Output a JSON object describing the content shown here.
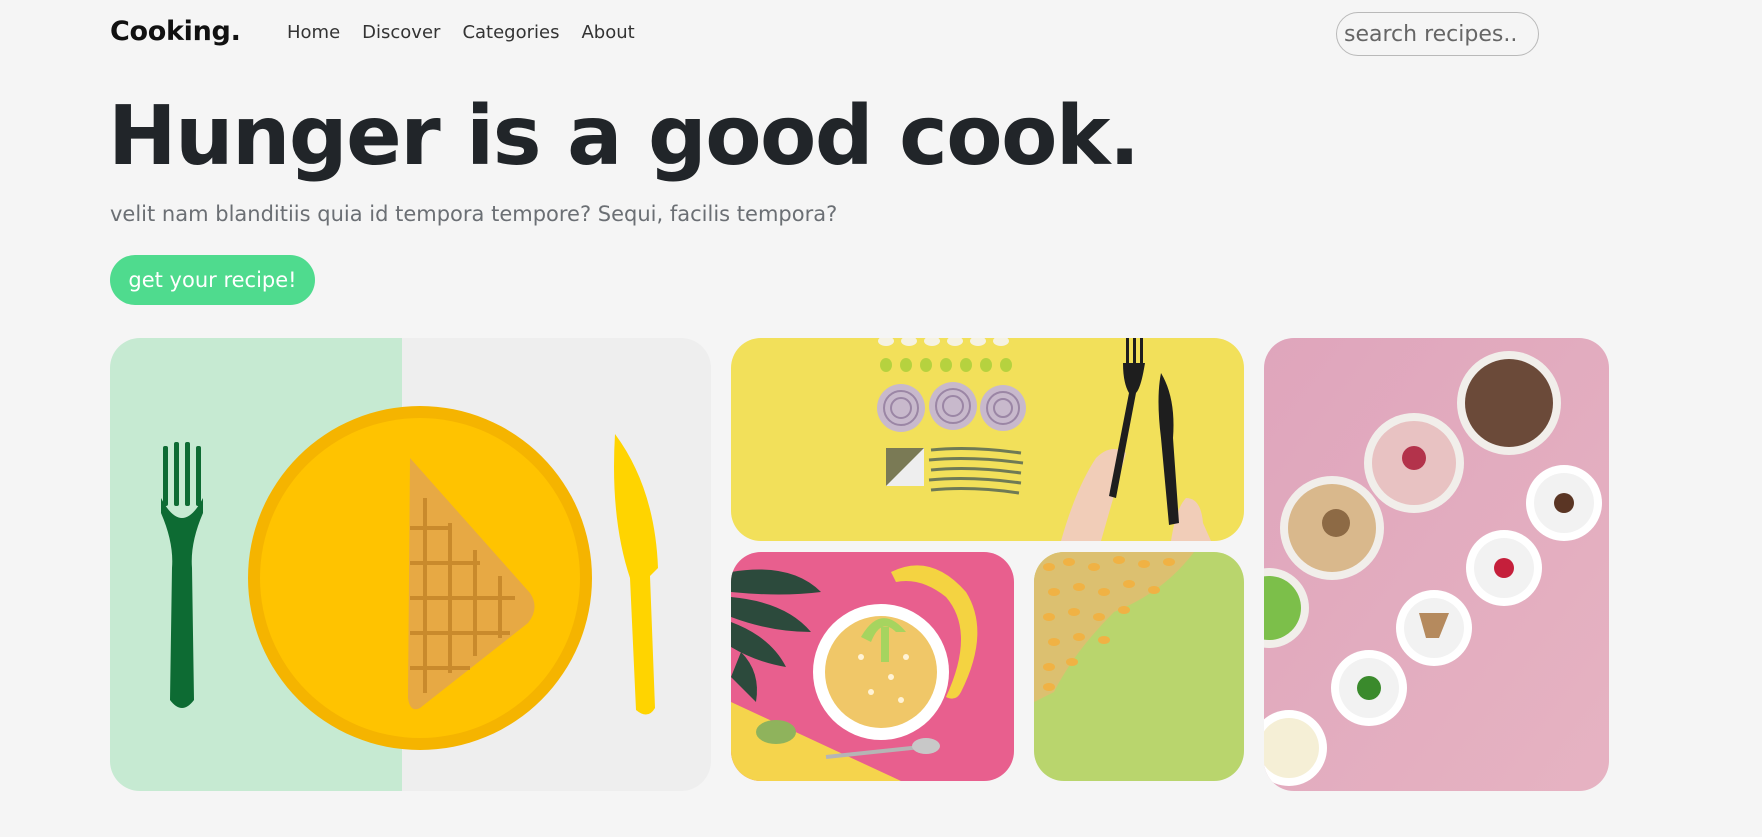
{
  "nav": {
    "brand": "Cooking.",
    "links": [
      "Home",
      "Discover",
      "Categories",
      "About"
    ],
    "search_placeholder": "search recipes.."
  },
  "hero": {
    "title": "Hunger is a good cook.",
    "subtitle": "velit nam blanditiis quia id tempora tempore? Sequi, facilis tempora?",
    "cta_label": "get your recipe!"
  },
  "colors": {
    "background": "#f5f5f5",
    "accent": "#4fdb8e",
    "heading": "#212529"
  },
  "icons": {
    "gallery": [
      "waffle-plate-photo",
      "onion-pasta-cutlery-photo",
      "smoothie-bowl-banana-photo",
      "corn-kernels-photo",
      "ice-cream-cups-photo"
    ]
  }
}
